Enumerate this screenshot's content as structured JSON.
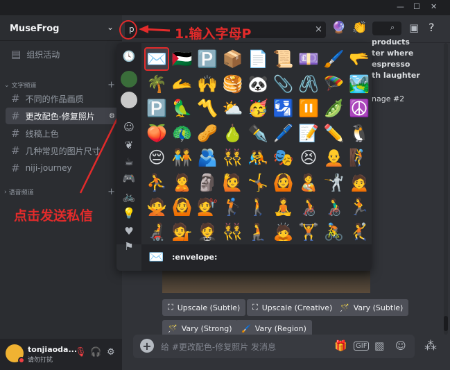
{
  "window": {
    "minimize": "—",
    "maximize": "☐",
    "close": "✕"
  },
  "server": {
    "name": "MuseFrog",
    "chevron": "⌄"
  },
  "channels": {
    "events": "组织活动",
    "text_category": "文字频道",
    "voice_category": "语音频道",
    "items": [
      {
        "name": "不同的作品画质",
        "active": false
      },
      {
        "name": "更改配色-修复照片",
        "active": true
      },
      {
        "name": "线稿上色",
        "active": false
      },
      {
        "name": "几种常见的图片尺寸",
        "active": false
      },
      {
        "name": "niji-journey",
        "active": false
      }
    ]
  },
  "user": {
    "name": "tonjiaoda...",
    "status": "请勿打扰"
  },
  "search": {
    "value": "p",
    "clear": "×"
  },
  "annotations": {
    "step1": "1.输入字母P",
    "step2": "点击发送私信"
  },
  "emoji_picker": {
    "categories": [
      "clock-icon",
      "server-icon-1",
      "server-icon-2",
      "smiley-icon",
      "leaf-icon",
      "food-icon",
      "gamepad-icon",
      "bike-icon",
      "lamp-icon",
      "heart-icon",
      "flag-icon"
    ],
    "rows": [
      [
        "✉️",
        "🇵🇸",
        "🅿️",
        "📦",
        "📄",
        "📜",
        "💷",
        "🖌️",
        "🫳"
      ],
      [
        "🌴",
        "🫴",
        "🙌",
        "🥞",
        "🐼",
        "📎",
        "🖇️",
        "🪂",
        "🏞️"
      ],
      [
        "🅿️",
        "🦜",
        "〽️",
        "⛅",
        "🥳",
        "🛂",
        "⏸️",
        "🫛",
        "☮️"
      ],
      [
        "🍑",
        "🦚",
        "🥜",
        "🍐",
        "✒️",
        "🖊️",
        "📝",
        "✏️",
        "🐧"
      ],
      [
        "😔",
        "🧑‍🤝‍🧑",
        "🫂",
        "👯",
        "🤼",
        "🎭",
        "😣",
        "🧑‍🦲",
        "🧗"
      ],
      [
        "⛹️",
        "🙎",
        "🗿",
        "🙋",
        "🤸",
        "🙆",
        "🧑‍🍼",
        "🤺",
        "🙍"
      ],
      [
        "🙅",
        "🙆",
        "💇",
        "🏌️",
        "🚶",
        "🧘",
        "🧑‍🦽",
        "👨‍🦽",
        "🏃"
      ],
      [
        "🧑‍🦼",
        "💁",
        "🤵",
        "👯",
        "🧎",
        "🙇",
        "🏋️",
        "🚴",
        "🤾"
      ]
    ],
    "selected_name": ":envelope:",
    "selected_emoji": "✉️"
  },
  "message": {
    "lines": [
      "products",
      "ter where",
      "espresso",
      "th laughter",
      "nage #2"
    ],
    "buttons": [
      {
        "icon": "⛶",
        "label": "Upscale (Subtle)"
      },
      {
        "icon": "⛶",
        "label": "Upscale (Creative)"
      },
      {
        "icon": "🪄",
        "label": "Vary (Subtle)"
      },
      {
        "icon": "🪄",
        "label": "Vary (Strong)"
      },
      {
        "icon": "🖌️",
        "label": "Vary (Region)"
      }
    ]
  },
  "chat": {
    "placeholder": "给 #更改配色-修复照片 发消息",
    "gif": "GIF"
  }
}
